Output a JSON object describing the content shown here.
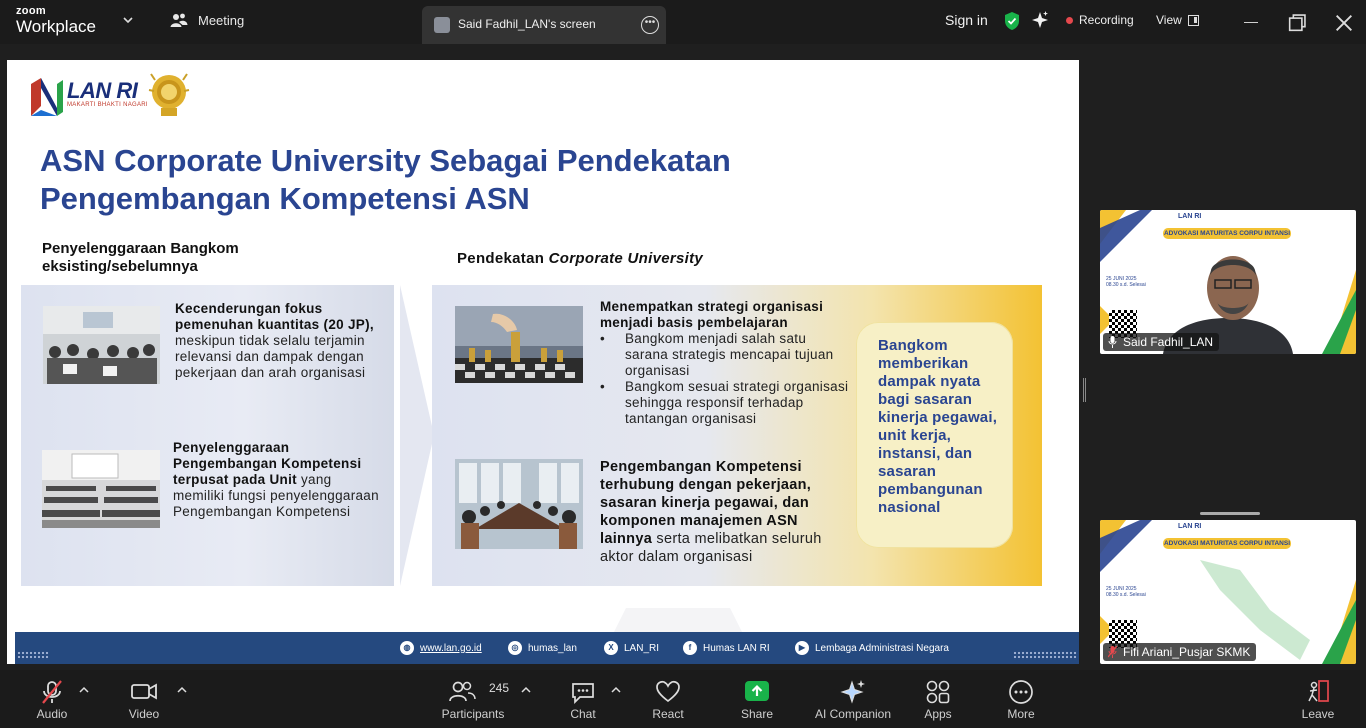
{
  "app": {
    "brand_top": "zoom",
    "brand_bottom": "Workplace",
    "meeting_label": "Meeting",
    "share_tab_label": "Said Fadhil_LAN's screen",
    "sign_in": "Sign in",
    "recording": "Recording",
    "view": "View"
  },
  "slide": {
    "logo_text": "LAN RI",
    "logo_sub": "MAKARTI BHAKTI NAGARI",
    "title_line1": "ASN Corporate University Sebagai Pendekatan",
    "title_line2": "Pengembangan Kompetensi ASN",
    "left_heading": "Penyelenggaraan Bangkom eksisting/sebelumnya",
    "right_heading_prefix": "Pendekatan ",
    "right_heading_em": "Corporate University",
    "left_item1_bold": "Kecenderungan fokus pemenuhan kuantitas (20 JP),",
    "left_item1_rest": " meskipun tidak selalu terjamin relevansi dan dampak dengan pekerjaan dan arah organisasi",
    "left_item2_bold": "Penyelenggaraan Pengembangan Kompetensi terpusat pada Unit",
    "left_item2_rest": " yang memiliki fungsi penyelenggaraan Pengembangan Kompetensi",
    "right_item1_bold": "Menempatkan strategi organisasi menjadi basis pembelajaran",
    "right_item1_bullets": [
      "Bangkom menjadi salah satu sarana strategis mencapai tujuan organisasi",
      "Bangkom sesuai strategi organisasi sehingga responsif terhadap tantangan organisasi"
    ],
    "right_item2_bold": "Pengembangan Kompetensi terhubung dengan pekerjaan, sasaran kinerja pegawai, dan komponen manajemen ASN lainnya",
    "right_item2_rest": " serta melibatkan seluruh aktor dalam organisasi",
    "callout": "Bangkom memberikan dampak nyata bagi sasaran kinerja pegawai, unit kerja, instansi, dan sasaran pembangunan nasional",
    "footer": {
      "website": "www.lan.go.id",
      "instagram": "humas_lan",
      "x": "LAN_RI",
      "facebook": "Humas LAN RI",
      "youtube": "Lembaga Administrasi Negara"
    }
  },
  "participants_tiles": [
    {
      "name": "Said Fadhil_LAN",
      "banner": "ADVOKASI MATURITAS CORPU INTANSI",
      "date": "25 JUNI 2025",
      "time": "08.30 s.d. Selesai"
    },
    {
      "name": "Fifi Ariani_Pusjar SKMK",
      "banner": "ADVOKASI MATURITAS CORPU INTANSI",
      "date": "25 JUNI 2025",
      "time": "08.30 s.d. Selesai"
    }
  ],
  "toolbar": {
    "audio": "Audio",
    "video": "Video",
    "participants": "Participants",
    "participants_count": "245",
    "chat": "Chat",
    "react": "React",
    "share": "Share",
    "ai_companion": "AI Companion",
    "apps": "Apps",
    "more": "More",
    "leave": "Leave"
  },
  "colors": {
    "accent_green": "#19b34a",
    "recording_red": "#e5484d",
    "slide_blue": "#2a4591",
    "slide_gold": "#f3c233"
  }
}
